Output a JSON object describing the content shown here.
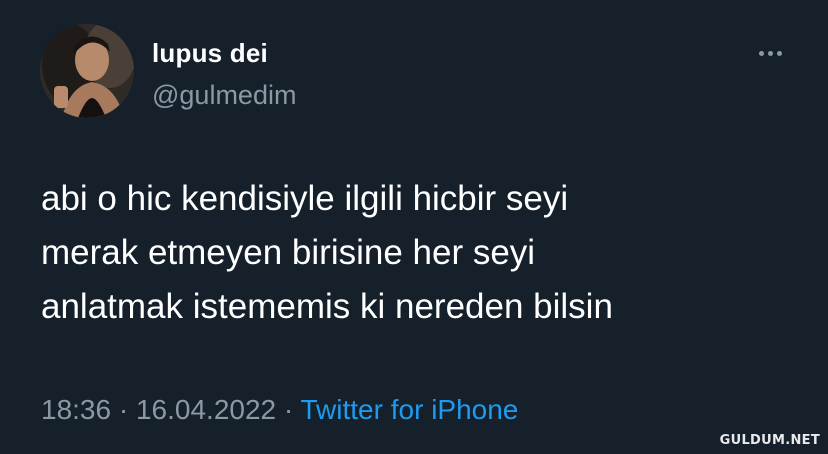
{
  "author": {
    "display_name": "lupus dei",
    "handle": "@gulmedim",
    "avatar_icon": "profile-photo"
  },
  "menu": {
    "icon": "more-horizontal-icon"
  },
  "tweet": {
    "lines": [
      "abi o hic kendisiyle ilgili hicbir seyi",
      "merak etmeyen birisine her seyi",
      "anlatmak istememis ki nereden bilsin"
    ]
  },
  "meta": {
    "time": "18:36",
    "separator": " · ",
    "date": "16.04.2022",
    "source": "Twitter for iPhone"
  },
  "watermark": "GULDUM.NET",
  "colors": {
    "background": "#15202b",
    "text": "#ffffff",
    "secondary": "#8b98a5",
    "accent": "#1d9bf0"
  }
}
